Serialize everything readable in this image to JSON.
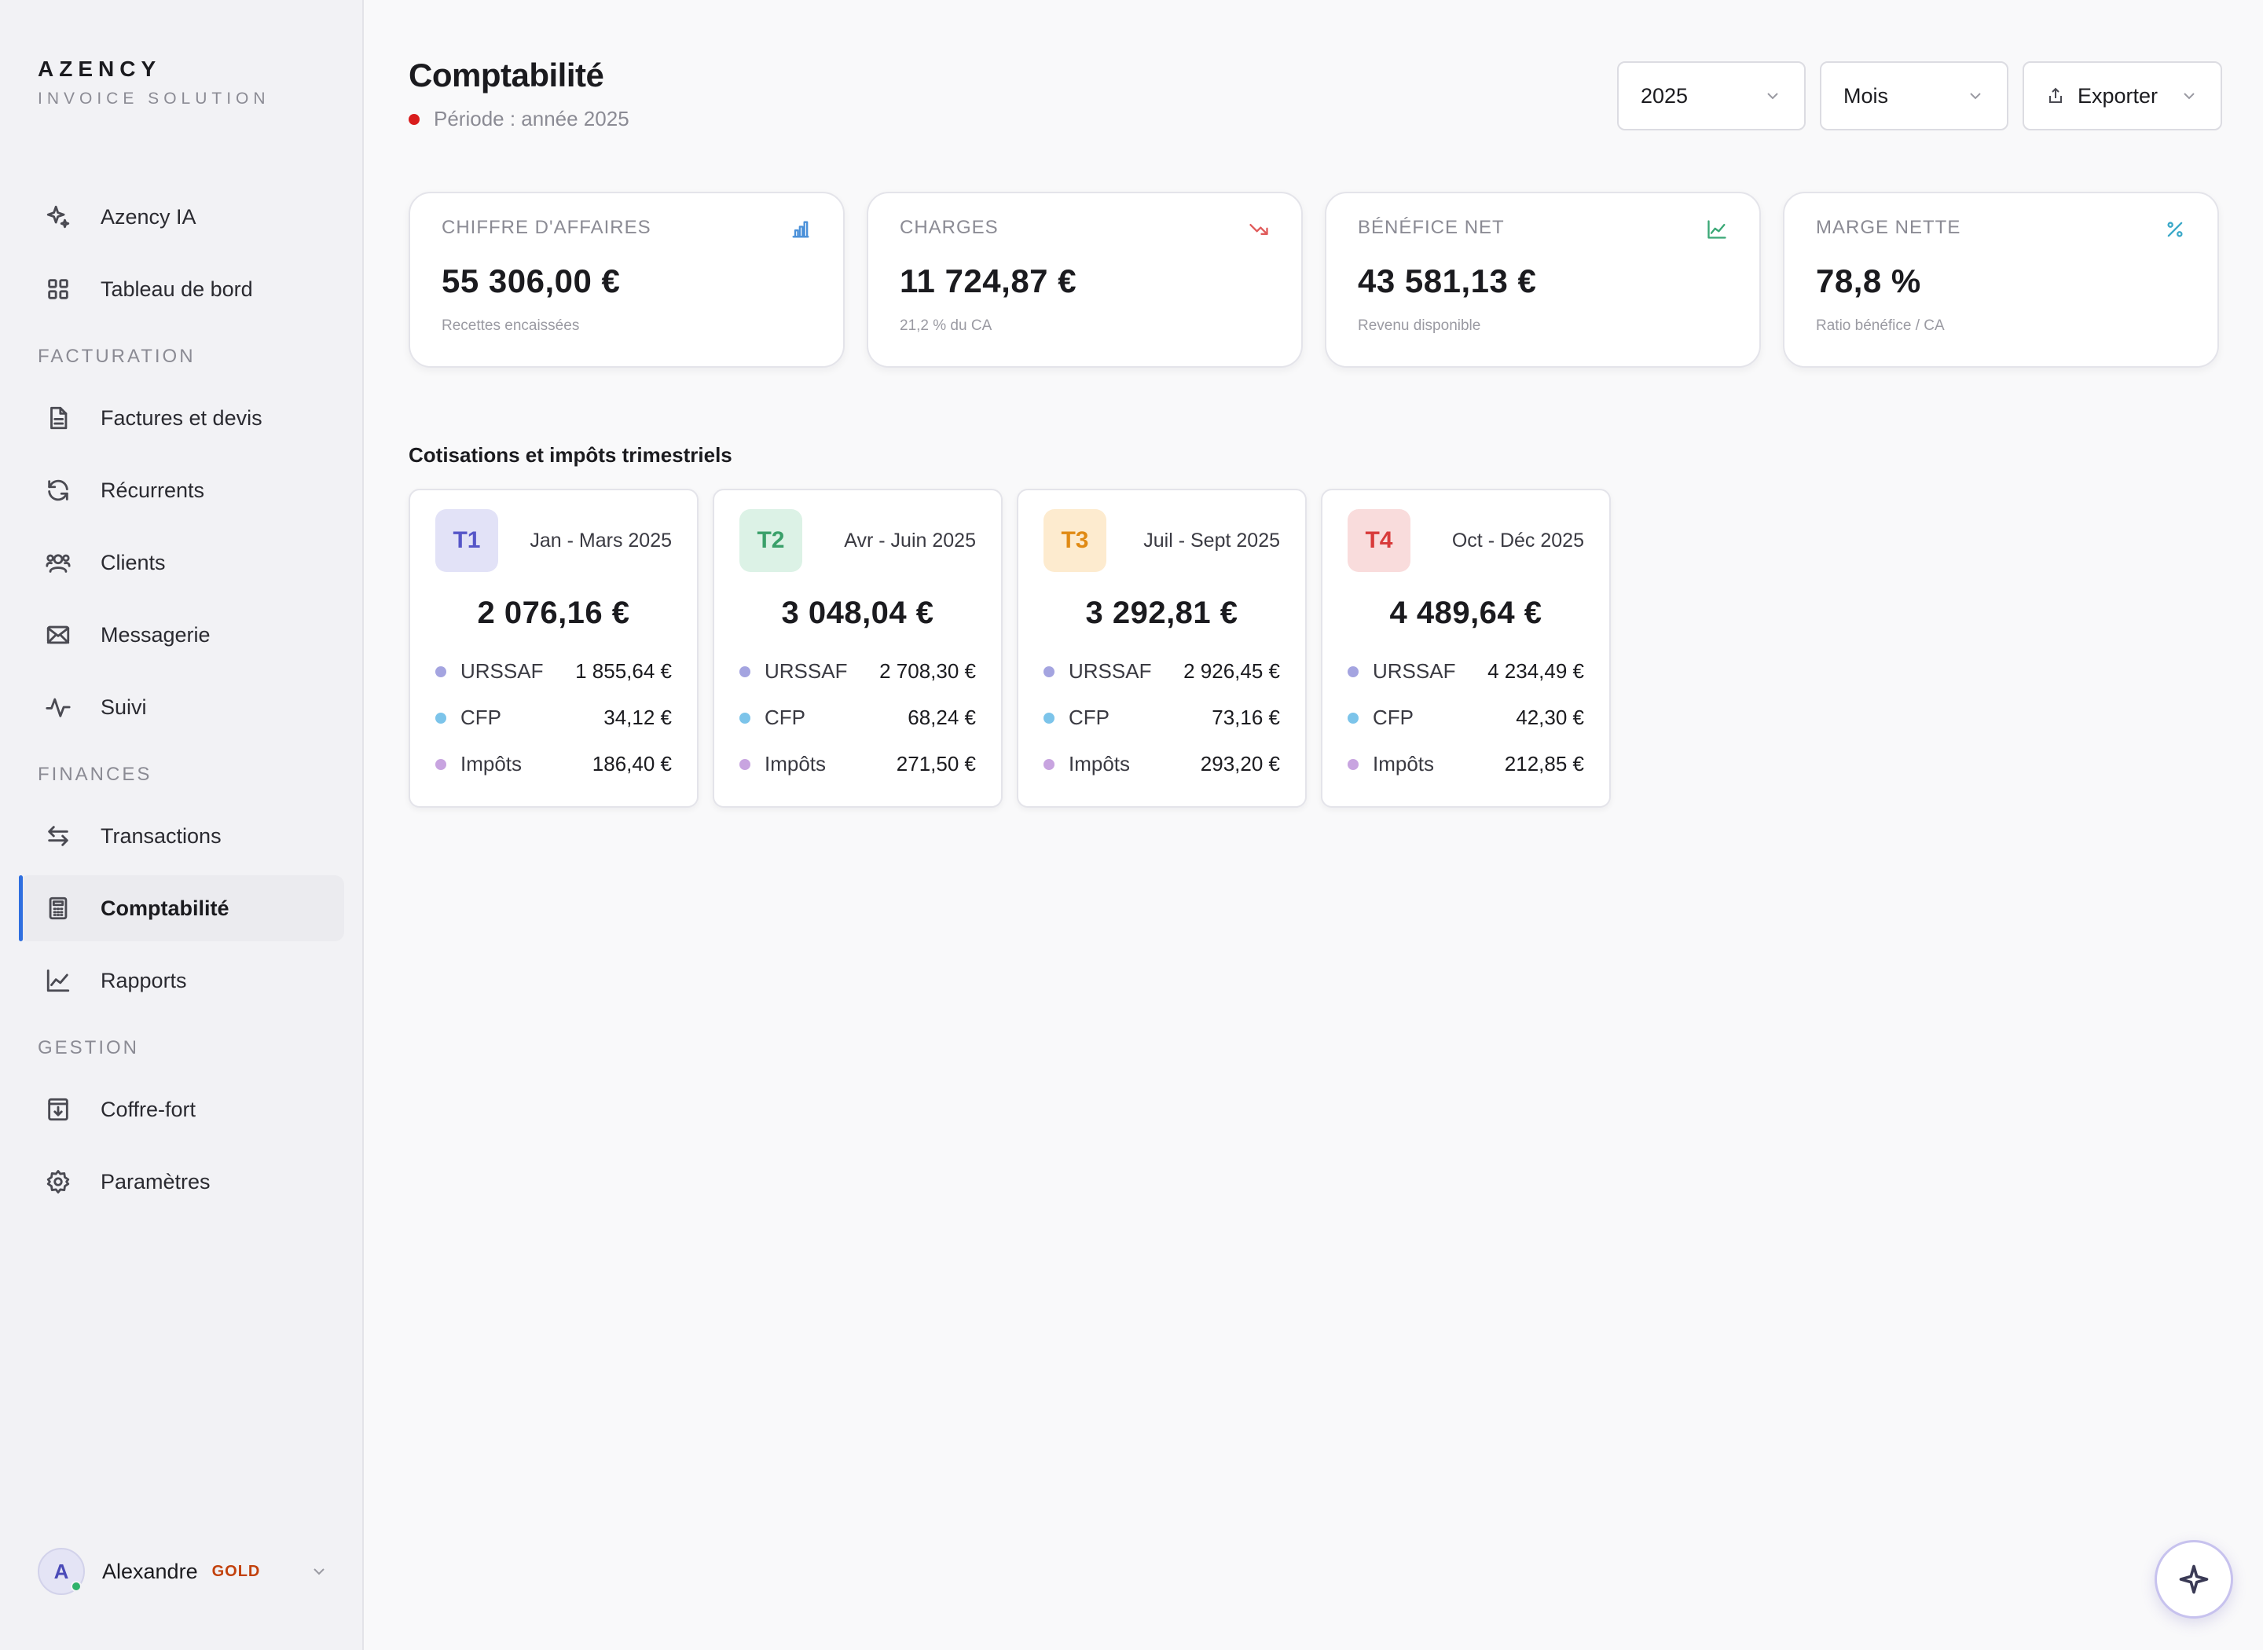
{
  "brand": {
    "name": "AZENCY",
    "subtitle": "INVOICE SOLUTION"
  },
  "nav": {
    "top": [
      {
        "label": "Azency IA",
        "icon": "sparkle-icon"
      },
      {
        "label": "Tableau de bord",
        "icon": "grid-icon"
      }
    ],
    "sections": [
      {
        "title": "FACTURATION",
        "items": [
          {
            "label": "Factures et devis",
            "icon": "document-icon"
          },
          {
            "label": "Récurrents",
            "icon": "refresh-icon"
          },
          {
            "label": "Clients",
            "icon": "users-icon"
          },
          {
            "label": "Messagerie",
            "icon": "mail-icon"
          },
          {
            "label": "Suivi",
            "icon": "activity-icon"
          }
        ]
      },
      {
        "title": "FINANCES",
        "items": [
          {
            "label": "Transactions",
            "icon": "arrows-icon"
          },
          {
            "label": "Comptabilité",
            "icon": "calculator-icon",
            "active": true
          },
          {
            "label": "Rapports",
            "icon": "line-chart-icon"
          }
        ]
      },
      {
        "title": "GESTION",
        "items": [
          {
            "label": "Coffre-fort",
            "icon": "archive-icon"
          },
          {
            "label": "Paramètres",
            "icon": "gear-icon"
          }
        ]
      }
    ]
  },
  "user": {
    "initial": "A",
    "name": "Alexandre",
    "badge": "GOLD"
  },
  "header": {
    "title": "Comptabilité",
    "period": "Période : année 2025",
    "year_select": "2025",
    "granularity_select": "Mois",
    "export_label": "Exporter"
  },
  "kpis": [
    {
      "label": "CHIFFRE D'AFFAIRES",
      "value": "55 306,00 €",
      "sub": "Recettes encaissées",
      "icon": "bar-chart-icon",
      "color": "#4a90d9"
    },
    {
      "label": "CHARGES",
      "value": "11 724,87 €",
      "sub": "21,2 % du CA",
      "icon": "trend-down-icon",
      "color": "#e05a5a"
    },
    {
      "label": "BÉNÉFICE NET",
      "value": "43 581,13 €",
      "sub": "Revenu disponible",
      "icon": "trend-up-icon",
      "color": "#3aa876"
    },
    {
      "label": "MARGE NETTE",
      "value": "78,8 %",
      "sub": "Ratio bénéfice / CA",
      "icon": "percent-icon",
      "color": "#3aa8c8"
    }
  ],
  "quarterly": {
    "title": "Cotisations et impôts trimestriels",
    "legend_colors": {
      "urssaf": "#a4a4e0",
      "cfp": "#7cc4ea",
      "impots": "#c8a4e0"
    },
    "quarters": [
      {
        "badge": "T1",
        "range": "Jan - Mars 2025",
        "total": "2 076,16 €",
        "urssaf": "1 855,64 €",
        "cfp": "34,12 €",
        "impots": "186,40 €",
        "bg": "#e2e2f7",
        "fg": "#5656c8"
      },
      {
        "badge": "T2",
        "range": "Avr - Juin 2025",
        "total": "3 048,04 €",
        "urssaf": "2 708,30 €",
        "cfp": "68,24 €",
        "impots": "271,50 €",
        "bg": "#dcf2e6",
        "fg": "#3aa06a"
      },
      {
        "badge": "T3",
        "range": "Juil - Sept 2025",
        "total": "3 292,81 €",
        "urssaf": "2 926,45 €",
        "cfp": "73,16 €",
        "impots": "293,20 €",
        "bg": "#fdebcf",
        "fg": "#e08a14"
      },
      {
        "badge": "T4",
        "range": "Oct - Déc 2025",
        "total": "4 489,64 €",
        "urssaf": "4 234,49 €",
        "cfp": "42,30 €",
        "impots": "212,85 €",
        "bg": "#f9dcdc",
        "fg": "#d83a3a"
      }
    ],
    "row_labels": {
      "urssaf": "URSSAF",
      "cfp": "CFP",
      "impots": "Impôts"
    }
  }
}
